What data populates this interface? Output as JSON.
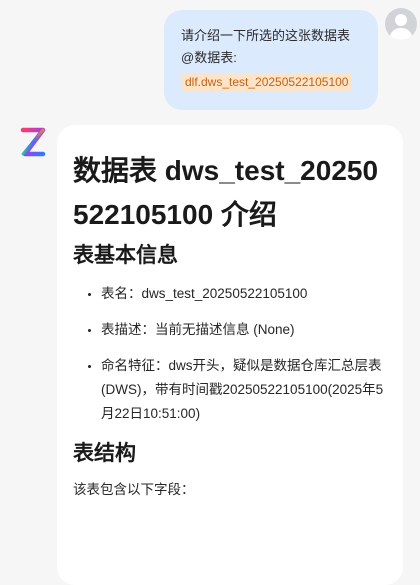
{
  "user_message": {
    "line1": "请介绍一下所选的这张数据表",
    "line2": "@数据表:",
    "dataset_tag": "dlf.dws_test_20250522105100"
  },
  "assistant": {
    "title": "数据表 dws_test_20250522105100 介绍",
    "section1_heading": "表基本信息",
    "basic_info": [
      "表名：dws_test_20250522105100",
      "表描述：当前无描述信息 (None)",
      "命名特征：dws开头，疑似是数据仓库汇总层表(DWS)，带有时间戳20250522105100(2025年5月22日10:51:00)"
    ],
    "section2_heading": "表结构",
    "structure_intro": "该表包含以下字段："
  },
  "icons": {
    "user_avatar": "user-avatar-icon",
    "assistant_logo": "assistant-logo-icon"
  },
  "colors": {
    "user_bubble": "#dceafe",
    "dataset_tag_bg": "#fde3c7",
    "dataset_tag_text": "#c06418",
    "page_bg": "#f6f6f7"
  }
}
